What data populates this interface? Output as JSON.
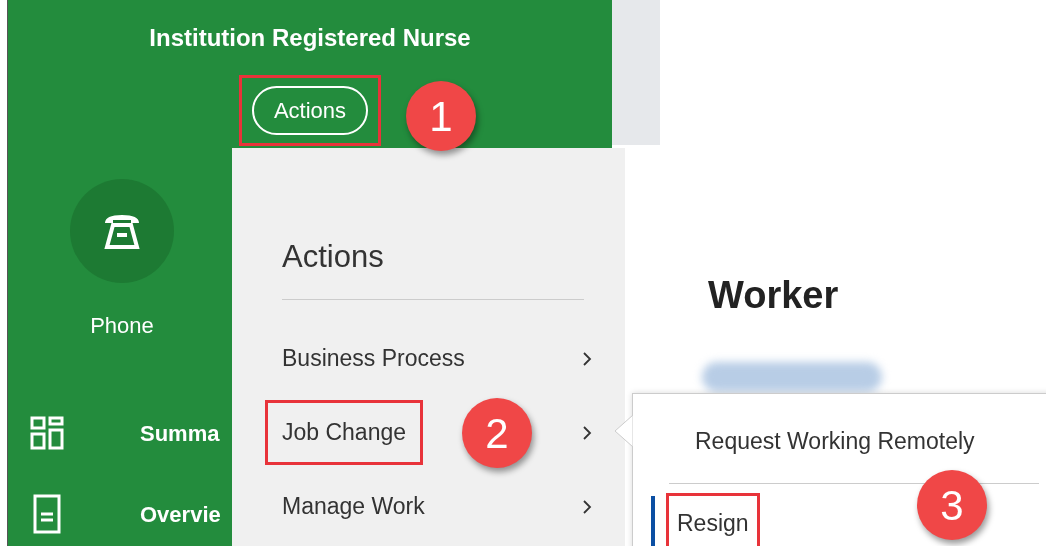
{
  "profile": {
    "title": "Institution Registered Nurse",
    "actions_button": {
      "label": "Actions",
      "highlighted": true
    },
    "contact": {
      "label": "Phone"
    },
    "nav": [
      {
        "kind": "summary",
        "label": "Summa"
      },
      {
        "kind": "overview",
        "label": "Overvie"
      }
    ]
  },
  "actions_menu": {
    "title": "Actions",
    "items": [
      {
        "label": "Business Process",
        "highlighted": false
      },
      {
        "label": "Job Change",
        "highlighted": true
      },
      {
        "label": "Manage Work",
        "highlighted": false
      }
    ]
  },
  "worker": {
    "heading": "Worker"
  },
  "submenu": {
    "items": [
      {
        "label": "Request Working Remotely",
        "selected": false,
        "highlighted": false
      },
      {
        "label": "Resign",
        "selected": true,
        "highlighted": true
      }
    ]
  },
  "callouts": [
    "1",
    "2",
    "3"
  ]
}
